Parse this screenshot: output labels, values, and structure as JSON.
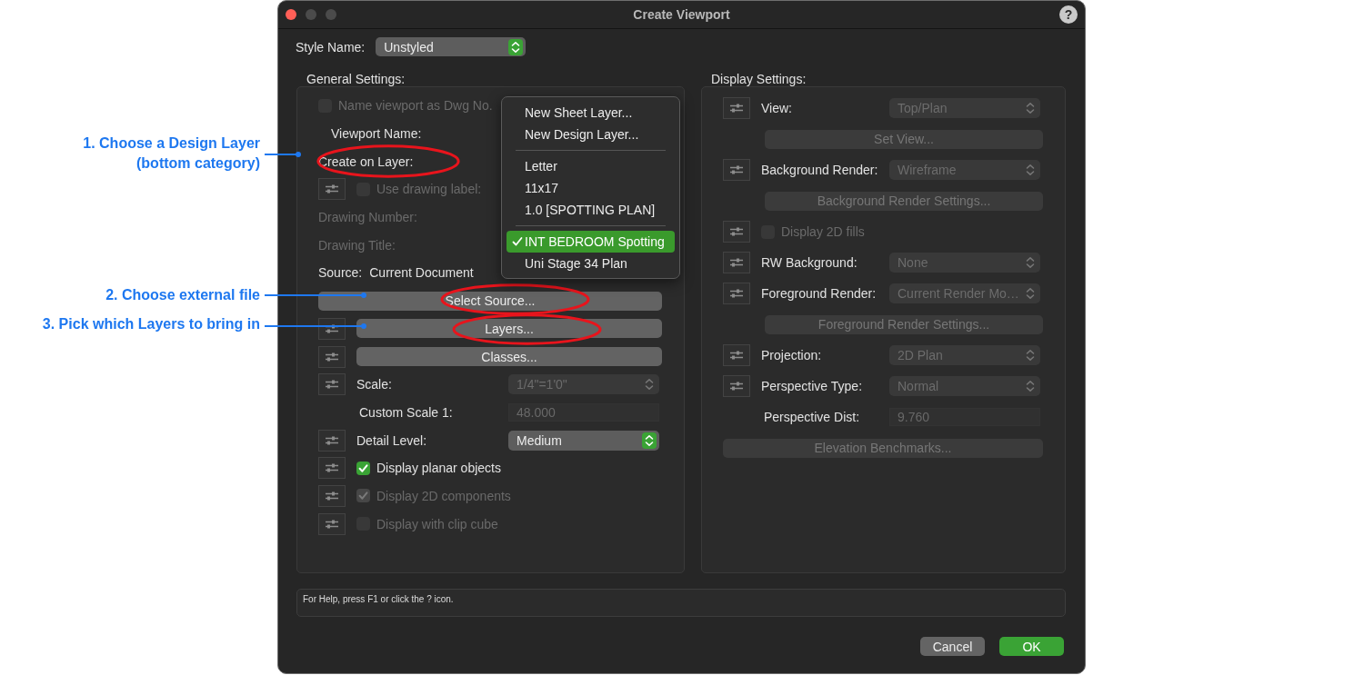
{
  "callouts": [
    {
      "text": "1. Choose a Design Layer\n(bottom category)"
    },
    {
      "text": "2. Choose external file"
    },
    {
      "text": "3. Pick which Layers to bring in"
    }
  ],
  "window": {
    "title": "Create Viewport",
    "help_button": "?"
  },
  "style_name": {
    "label": "Style Name:",
    "value": "Unstyled",
    "disabled": false
  },
  "general_settings": {
    "title": "General Settings:",
    "rows": [
      {
        "kind": "checkbox",
        "label": "Name viewport as Dwg No.",
        "options": false,
        "checked": false,
        "disabled": true,
        "circled": false
      },
      {
        "kind": "label",
        "label": "Viewport Name:",
        "options": false,
        "disabled": false,
        "circled": false
      },
      {
        "kind": "label",
        "label": "Create on Layer:",
        "options": false,
        "disabled": false,
        "circled": true
      },
      {
        "kind": "checkbox",
        "label": "Use drawing label:",
        "options": true,
        "checked": false,
        "disabled": true,
        "circled": false
      },
      {
        "kind": "label",
        "label": "Drawing Number:",
        "options": false,
        "disabled": true,
        "circled": false
      },
      {
        "kind": "label",
        "label": "Drawing Title:",
        "options": false,
        "disabled": true,
        "circled": false
      },
      {
        "kind": "source",
        "label": "Source:",
        "value": "Current Document",
        "options": false,
        "circled": false
      },
      {
        "kind": "button",
        "label": "Select Source...",
        "options": false,
        "disabled": false,
        "circled": true
      },
      {
        "kind": "button",
        "label": "Layers...",
        "options": true,
        "disabled": false,
        "circled": true
      },
      {
        "kind": "button",
        "label": "Classes...",
        "options": true,
        "disabled": false,
        "circled": false
      },
      {
        "kind": "popup",
        "label": "Scale:",
        "value": "1/4\"=1'0\"",
        "options": true,
        "disabled": true,
        "circled": false
      },
      {
        "kind": "field",
        "label": "Custom Scale 1:",
        "value": "48.000",
        "options": false,
        "disabled": true,
        "circled": false
      },
      {
        "kind": "popup",
        "label": "Detail Level:",
        "value": "Medium",
        "options": true,
        "disabled": false,
        "circled": false
      },
      {
        "kind": "checkbox",
        "label": "Display planar objects",
        "options": true,
        "checked": true,
        "disabled": false,
        "circled": false
      },
      {
        "kind": "checkbox",
        "label": "Display 2D components",
        "options": true,
        "checked": true,
        "disabled": true,
        "circled": false
      },
      {
        "kind": "checkbox",
        "label": "Display with clip cube",
        "options": true,
        "checked": false,
        "disabled": true,
        "circled": false
      }
    ]
  },
  "layer_menu": {
    "sections": [
      {
        "items": [
          {
            "label": "New Sheet Layer...",
            "selected": false
          },
          {
            "label": "New Design Layer...",
            "selected": false
          }
        ]
      },
      {
        "items": [
          {
            "label": "Letter",
            "selected": false
          },
          {
            "label": "11x17",
            "selected": false
          },
          {
            "label": "1.0 [SPOTTING PLAN]",
            "selected": false
          }
        ]
      },
      {
        "items": [
          {
            "label": "INT BEDROOM Spotting",
            "selected": true
          },
          {
            "label": "Uni Stage 34 Plan",
            "selected": false
          }
        ]
      }
    ]
  },
  "display_settings": {
    "title": "Display Settings:",
    "rows": [
      {
        "kind": "popup",
        "label": "View:",
        "value": "Top/Plan",
        "options": true,
        "disabled": true
      },
      {
        "kind": "button",
        "label": "Set View...",
        "options": false,
        "disabled": true
      },
      {
        "kind": "popup",
        "label": "Background Render:",
        "value": "Wireframe",
        "options": true,
        "disabled": true
      },
      {
        "kind": "button",
        "label": "Background Render Settings...",
        "options": false,
        "disabled": true
      },
      {
        "kind": "checkbox",
        "label": "Display 2D fills",
        "options": true,
        "checked": false,
        "disabled": true
      },
      {
        "kind": "popup",
        "label": "RW Background:",
        "value": "None",
        "options": true,
        "disabled": true
      },
      {
        "kind": "popup",
        "label": "Foreground Render:",
        "value": "Current Render Mo…",
        "options": true,
        "disabled": true
      },
      {
        "kind": "button",
        "label": "Foreground Render Settings...",
        "options": false,
        "disabled": true
      },
      {
        "kind": "popup",
        "label": "Projection:",
        "value": "2D Plan",
        "options": true,
        "disabled": true
      },
      {
        "kind": "popup",
        "label": "Perspective Type:",
        "value": "Normal",
        "options": true,
        "disabled": true
      },
      {
        "kind": "field",
        "label": "Perspective Dist:",
        "value": "9.760",
        "options": false,
        "disabled": true
      },
      {
        "kind": "button",
        "label": "Elevation Benchmarks...",
        "options": false,
        "disabled": true
      }
    ]
  },
  "help_bar": {
    "text": "For Help, press F1 or click the ? icon."
  },
  "buttons": [
    {
      "label": "Cancel",
      "default": false
    },
    {
      "label": "OK",
      "default": true
    }
  ]
}
